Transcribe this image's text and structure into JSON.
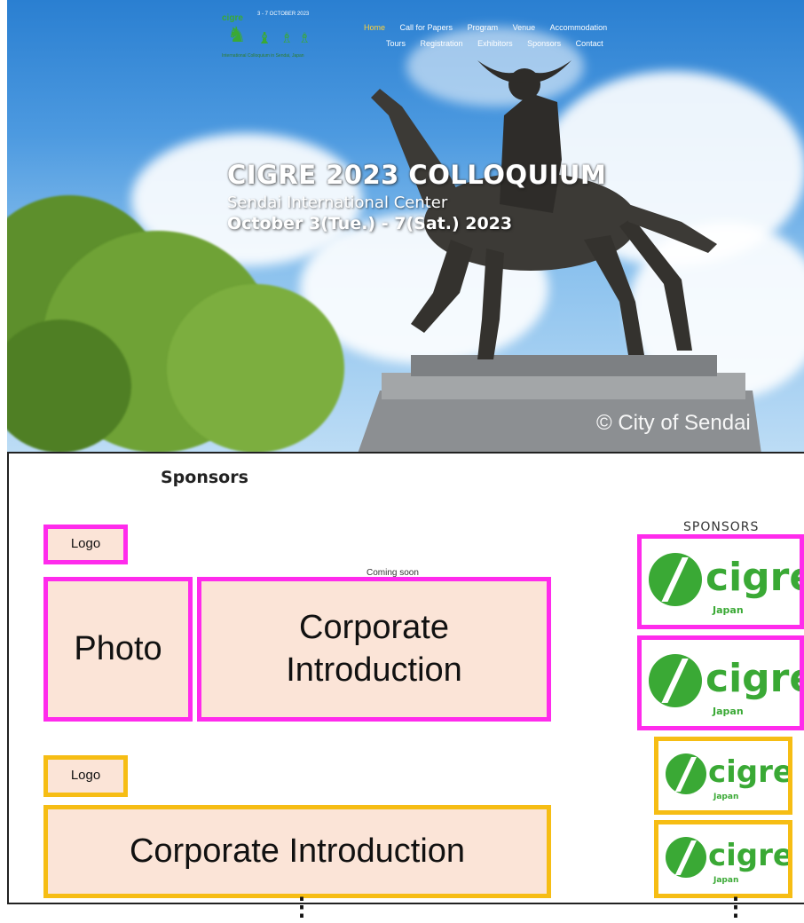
{
  "site": {
    "brand": "cigre",
    "dates": "3 - 7 OCTOBER 2023",
    "subtitle": "International Colloquium in Sendai, Japan"
  },
  "nav": {
    "row1": [
      "Home",
      "Call for Papers",
      "Program",
      "Venue",
      "Accommodation"
    ],
    "row2": [
      "Tours",
      "Registration",
      "Exhibitors",
      "Sponsors",
      "Contact"
    ],
    "active": "Home",
    "active_color": "#ffd23a"
  },
  "hero": {
    "title": "CIGRE 2023 COLLOQUIUM",
    "venue": "Sendai International Center",
    "date": "October 3(Tue.) - 7(Sat.) 2023",
    "copyright": "© City of Sendai"
  },
  "sponsors_section": {
    "title": "Sponsors",
    "coming_soon": "Coming soon",
    "tier1": {
      "logo_label": "Logo",
      "photo_label": "Photo",
      "intro_label": "Corporate Introduction",
      "border_color": "#ff2bec"
    },
    "tier2": {
      "logo_label": "Logo",
      "intro_label": "Corporate Introduction",
      "border_color": "#f6bd14"
    },
    "box_fill": "#fbe4d7"
  },
  "sidebar": {
    "title": "SPONSORS",
    "logo_word": "cigre",
    "logo_country": "Japan",
    "logo_color": "#3aa935"
  },
  "more_indicator": "⋮"
}
